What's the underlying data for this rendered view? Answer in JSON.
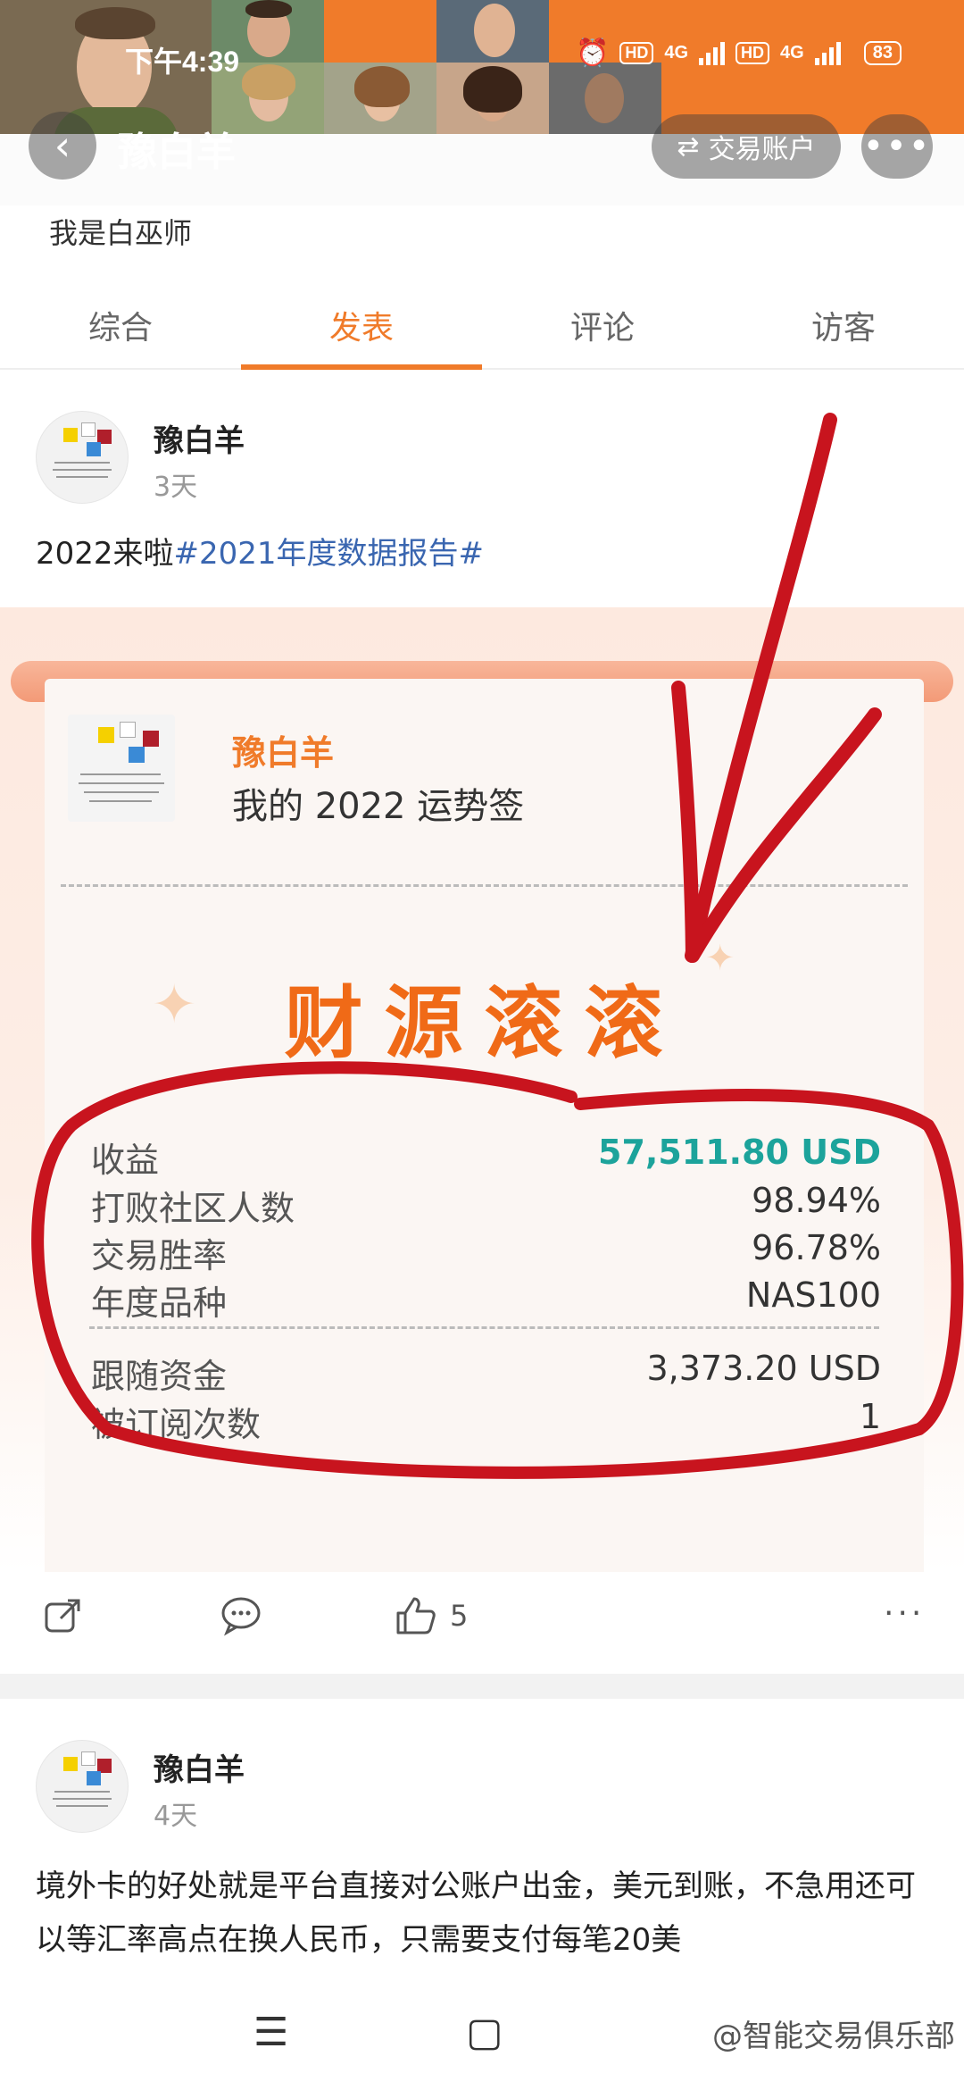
{
  "status": {
    "time": "下午4:39",
    "net1": "4G",
    "net2": "4G",
    "hd": "HD",
    "battery": "83"
  },
  "header": {
    "title": "豫白羊",
    "trade_button": "交易账户",
    "back_icon": "back-arrow-icon",
    "more_icon": "more-dots-icon"
  },
  "profile": {
    "bio": "我是白巫师"
  },
  "tabs": [
    {
      "label": "综合",
      "active": false
    },
    {
      "label": "发表",
      "active": true
    },
    {
      "label": "评论",
      "active": false
    },
    {
      "label": "访客",
      "active": false
    }
  ],
  "post1": {
    "author": "豫白羊",
    "time": "3天",
    "text": "2022来啦",
    "hashtag": "#2021年度数据报告#",
    "card": {
      "name": "豫白羊",
      "subtitle": "我的 2022 运势签",
      "fortune": "财源滚滚",
      "stats": [
        {
          "label": "收益",
          "value": "57,511.80 USD"
        },
        {
          "label": "打败社区人数",
          "value": "98.94%"
        },
        {
          "label": "交易胜率",
          "value": "96.78%"
        },
        {
          "label": "年度品种",
          "value": "NAS100"
        },
        {
          "label": "跟随资金",
          "value": "3,373.20 USD"
        },
        {
          "label": "被订阅次数",
          "value": "1"
        }
      ]
    },
    "likes": "5"
  },
  "post2": {
    "author": "豫白羊",
    "time": "4天",
    "text": "境外卡的好处就是平台直接对公账户出金，美元到账，不急用还可以等汇率高点在换人民币，只需要支付每笔20美"
  },
  "watermark": "@智能交易俱乐部",
  "colors": {
    "accent": "#f07b2a",
    "green": "#1ca39b",
    "link": "#3a66b0",
    "annotation": "#c8141e"
  }
}
